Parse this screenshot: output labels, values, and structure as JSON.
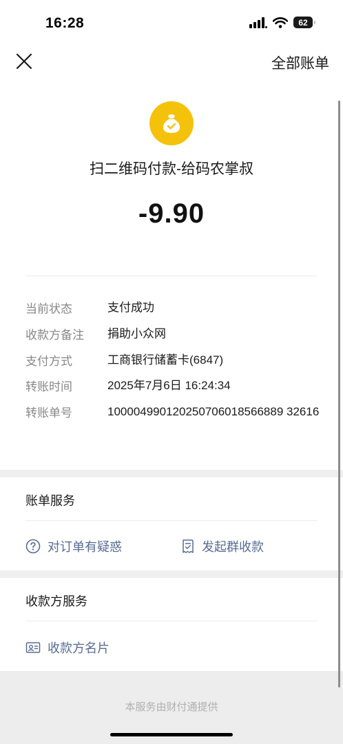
{
  "status_bar": {
    "time": "16:28",
    "battery": "62"
  },
  "nav": {
    "right_label": "全部账单"
  },
  "transaction": {
    "merchant_name": "扫二维码付款-给码农掌叔",
    "amount": "-9.90"
  },
  "details": [
    {
      "label": "当前状态",
      "value": "支付成功"
    },
    {
      "label": "收款方备注",
      "value": "捐助小众网"
    },
    {
      "label": "支付方式",
      "value": "工商银行储蓄卡(6847)"
    },
    {
      "label": "转账时间",
      "value": "2025年7月6日 16:24:34"
    },
    {
      "label": "转账单号",
      "value": "100004990120250706018566889 32616"
    }
  ],
  "bill_service": {
    "title": "账单服务",
    "question_label": "对订单有疑惑",
    "group_collect_label": "发起群收款"
  },
  "payee_service": {
    "title": "收款方服务",
    "card_label": "收款方名片"
  },
  "footer": {
    "text": "本服务由财付通提供"
  },
  "colors": {
    "accent_link": "#576b95",
    "logo_bg": "#f5c20b"
  },
  "icons": [
    "close-icon",
    "money-bag-icon",
    "question-circle-icon",
    "group-bill-icon",
    "business-card-icon",
    "signal-icon",
    "wifi-icon",
    "battery-icon"
  ]
}
